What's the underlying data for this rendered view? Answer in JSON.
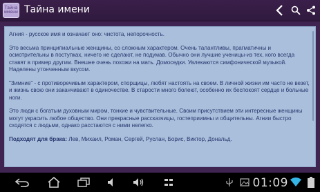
{
  "app": {
    "icon_text": "Тайна имени",
    "title": "Тайна имени"
  },
  "article": {
    "paragraphs": [
      "Агния - русское имя и означает оно: чистота, непорочность.",
      "Это весьма принципиальные женщины, со сложным характером. Очень талантливы, прагматичны и осмотрительны в поступках, ничего не сделают, не подумав. Обычно они лучшие ученицы-из тех, кого всегда ставят в пример другим. Внешне очень похожи на мать. Домоседки. Увлекаются симфонической музыкой. Наделены утонченным вкусом.",
      "\"Зимние\" - с противоречивым характером, спорщицы, любят настоять на своем. В личной жизни им часто не везет, и жизнь свою они заканчивают в одиночестве. В старости много болеют, особенно их беспокоят сердце и больные ноги.",
      "Это люди с богатым духовным миром, тонкие и чувствительные. Своим присутствием эти интересные женщины могут украсить любое общество. Они прекрасные рассказчицы, гостеприимны и общительны. Агнии быстро сходятся с людьми, однако расстаются с ними нелегко."
    ],
    "match_label": "Подходят для брака:",
    "match_names": " Лев, Михаил, Роман, Сергей, Руслан, Борис, Виктор, Дональд."
  },
  "status": {
    "clock": "01:09"
  },
  "colors": {
    "actionbar": "#3a1f4a",
    "content_bg": "#aabfdb",
    "text": "#26356e",
    "wifi": "#33b5e5"
  }
}
